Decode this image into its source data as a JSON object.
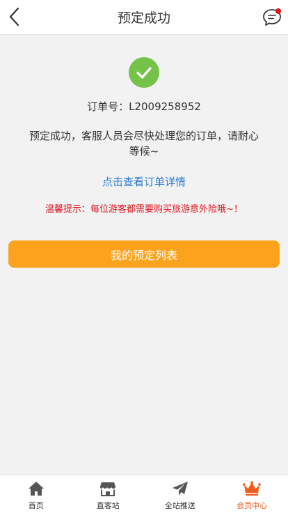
{
  "header": {
    "title": "预定成功"
  },
  "result": {
    "order_label": "订单号：",
    "order_no": "L2009258952",
    "message": "预定成功，客服人员会尽快处理您的订单，请耐心等候~",
    "detail_link": "点击查看订单详情",
    "tip": "温馨提示：每位游客都需要购买旅游意外险哦~！",
    "list_button": "我的预定列表"
  },
  "colors": {
    "success": "#74c247",
    "accent": "#fba31c",
    "link": "#2a7ad2",
    "warning": "#e0141d",
    "active_tab": "#f05a1a"
  },
  "tabbar": {
    "items": [
      {
        "label": "首页",
        "icon": "home-icon"
      },
      {
        "label": "直客站",
        "icon": "store-icon"
      },
      {
        "label": "全站推送",
        "icon": "send-icon"
      },
      {
        "label": "会员中心",
        "icon": "crown-icon",
        "active": true
      }
    ]
  }
}
